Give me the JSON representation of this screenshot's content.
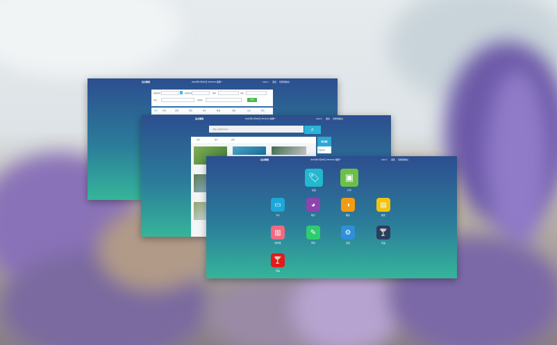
{
  "window_top": {
    "app_title": "后台管理",
    "datetime": "2021年07月05日 08:30:00 星期一",
    "user": "Admin",
    "links": [
      "退出",
      "切换到前台"
    ],
    "filters": {
      "row1": [
        "开始时间",
        "结束时间",
        "类型",
        "状态"
      ],
      "row2": [
        "状态",
        "关键词"
      ],
      "search_label": "查询"
    },
    "columns": [
      "序号",
      "名称",
      "日期",
      "类型",
      "编号",
      "数量",
      "金额",
      "状态",
      "操作"
    ]
  },
  "window_middle": {
    "app_title": "后台管理",
    "datetime": "2021年07月05日 08:30:00 星期一",
    "user": "Admin",
    "links": [
      "退出",
      "切换到前台"
    ],
    "search_placeholder": "请输入要搜索的内容",
    "tabs": [
      "推荐",
      "热门",
      "更多"
    ],
    "side_badge": "新功能",
    "side_link": "查看详情"
  },
  "window_front": {
    "app_title": "后台管理",
    "datetime": "2021年07月05日 08:30:00 星期一",
    "user": "Admin",
    "links": [
      "退出",
      "切换到前台"
    ],
    "tiles": [
      {
        "label": "标签",
        "icon": "🏷",
        "color": "#22b8cf"
      },
      {
        "label": "打印",
        "icon": "▣",
        "color": "#6cc04a"
      },
      {
        "label": "卡片",
        "icon": "▭",
        "color": "#1ea7d9"
      },
      {
        "label": "统计",
        "icon": "◕",
        "color": "#8e44ad"
      },
      {
        "label": "图表",
        "icon": "◑",
        "color": "#f39c12"
      },
      {
        "label": "报表",
        "icon": "▤",
        "color": "#f1c40f"
      },
      {
        "label": "收件箱",
        "icon": "▥",
        "color": "#f06b82"
      },
      {
        "label": "申请",
        "icon": "✎",
        "color": "#2ecc71"
      },
      {
        "label": "设置",
        "icon": "⚙",
        "color": "#2f8fd8"
      },
      {
        "label": "饮品",
        "icon": "🍸",
        "color": "#2c3e60"
      },
      {
        "label": "饮品",
        "icon": "🍸",
        "color": "#e31b1b"
      }
    ]
  }
}
